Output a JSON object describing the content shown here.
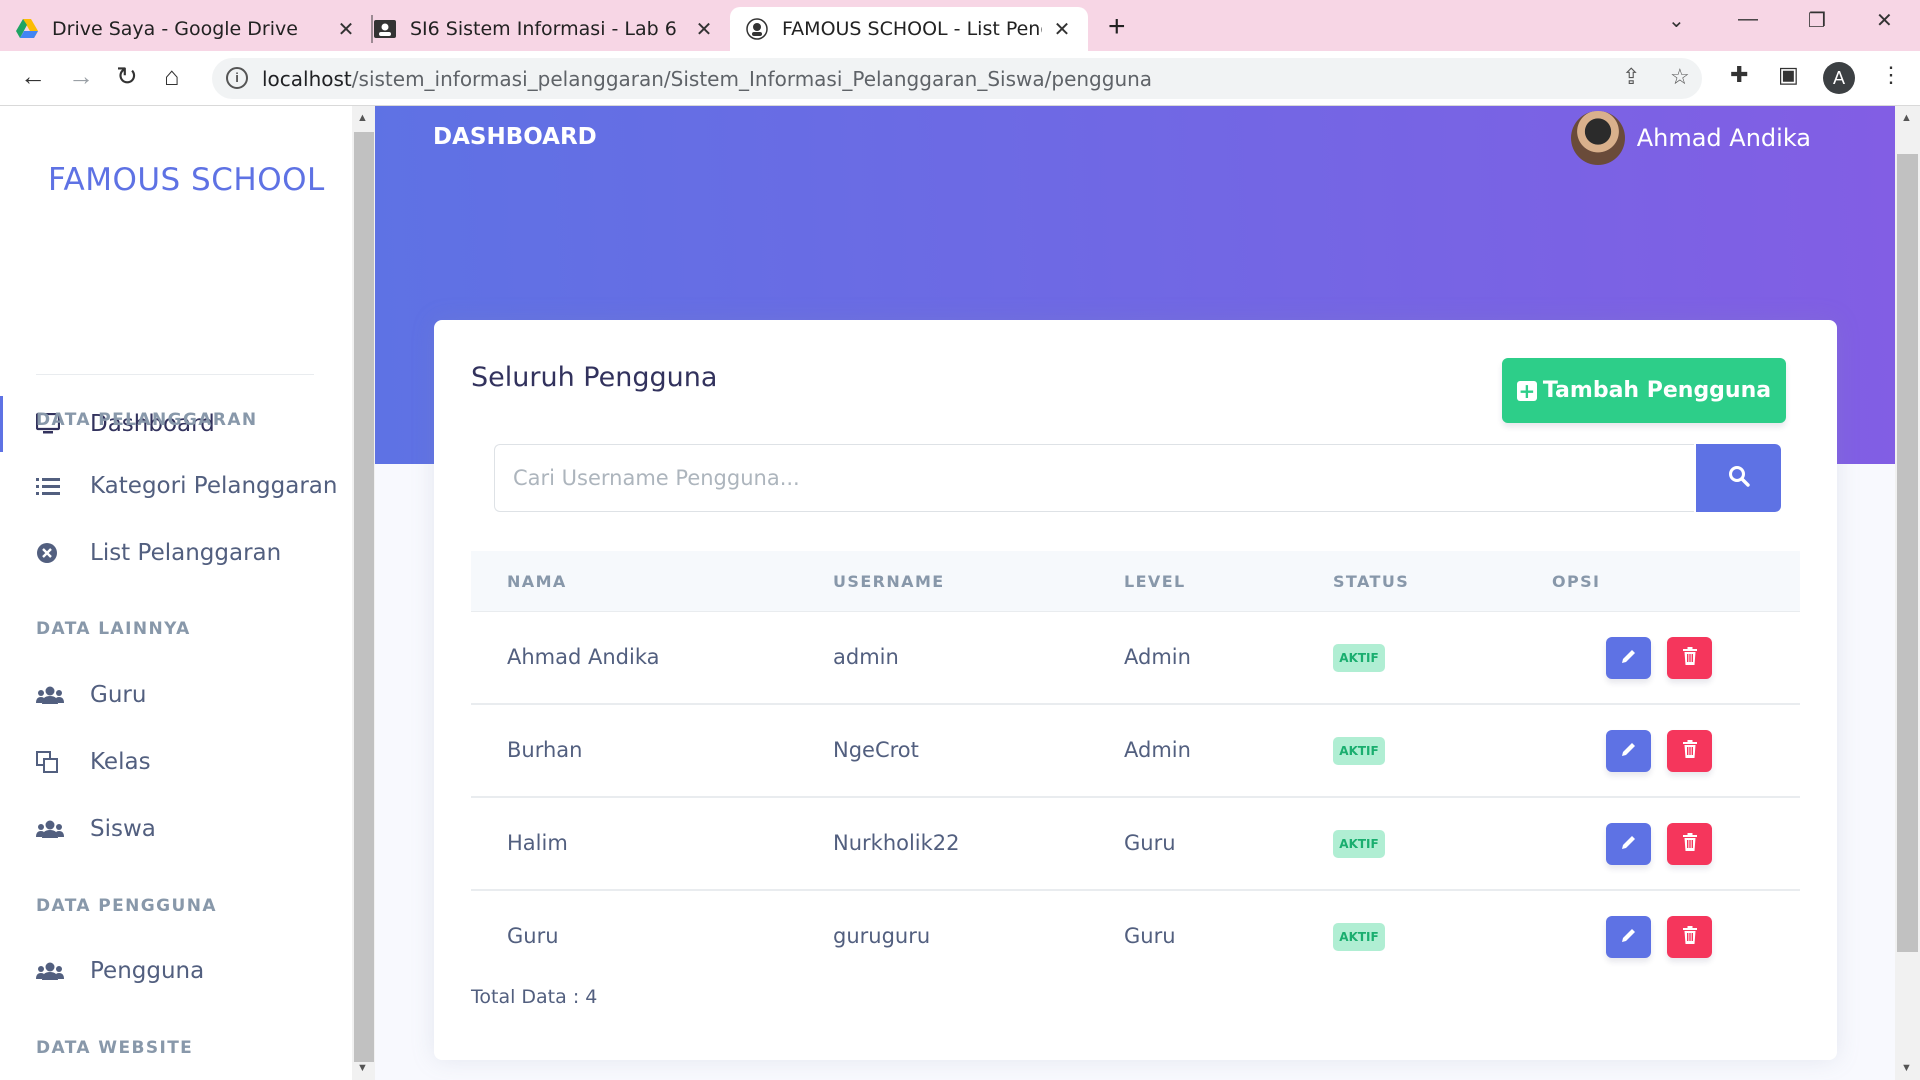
{
  "browser": {
    "tabs": [
      {
        "title": "Drive Saya - Google Drive",
        "active": false
      },
      {
        "title": "SI6 Sistem Informasi - Lab 6",
        "active": false
      },
      {
        "title": "FAMOUS SCHOOL - List Penggun",
        "active": true
      }
    ],
    "url_host": "localhost",
    "url_path": "/sistem_informasi_pelanggaran/Sistem_Informasi_Pelanggaran_Siswa/pengguna",
    "profile_initial": "A"
  },
  "sidebar": {
    "brand": "FAMOUS SCHOOL",
    "dashboard": "Dashboard",
    "headings": {
      "pelanggaran": "DATA PELANGGARAN",
      "lainnya": "DATA LAINNYA",
      "pengguna": "DATA PENGGUNA",
      "website": "DATA WEBSITE"
    },
    "items": {
      "kategori": "Kategori Pelanggaran",
      "list": "List Pelanggaran",
      "guru": "Guru",
      "kelas": "Kelas",
      "siswa": "Siswa",
      "pengguna": "Pengguna"
    }
  },
  "header": {
    "title": "DASHBOARD",
    "user_name": "Ahmad Andika"
  },
  "card": {
    "title": "Seluruh Pengguna",
    "add_button": "Tambah Pengguna",
    "search_placeholder": "Cari Username Pengguna...",
    "columns": [
      "NAMA",
      "USERNAME",
      "LEVEL",
      "STATUS",
      "OPSI"
    ],
    "rows": [
      {
        "nama": "Ahmad Andika",
        "username": "admin",
        "level": "Admin",
        "status": "AKTIF"
      },
      {
        "nama": "Burhan",
        "username": "NgeCrot",
        "level": "Admin",
        "status": "AKTIF"
      },
      {
        "nama": "Halim",
        "username": "Nurkholik22",
        "level": "Guru",
        "status": "AKTIF"
      },
      {
        "nama": "Guru",
        "username": "guruguru",
        "level": "Guru",
        "status": "AKTIF"
      }
    ],
    "total": "Total Data : 4"
  },
  "colors": {
    "primary": "#5e72e4",
    "success": "#2dce89",
    "danger": "#f5365c",
    "tabbar": "#f7d6e5"
  }
}
